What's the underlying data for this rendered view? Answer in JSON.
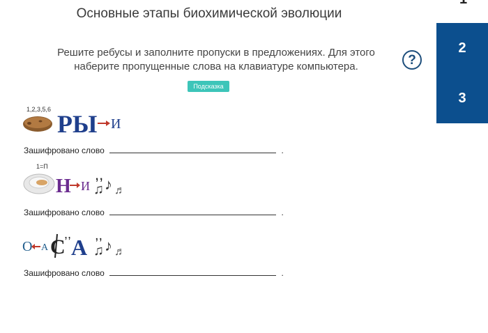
{
  "title": "Основные этапы биохимической эволюции",
  "instructions": {
    "line1": "Решите ребусы и заполните пропуски в предложениях. Для этого",
    "line2": "наберите пропущенные слова на клавиатуре компьютера."
  },
  "help_symbol": "?",
  "hint_button": "Подсказка",
  "nav": {
    "top": "1",
    "item2": "2",
    "item3": "3"
  },
  "rebuses": [
    {
      "caption": "1,2,3,5,6",
      "letters1": "РЫ",
      "letters2": "И",
      "answer_label": "Зашифровано слово",
      "answer_value": "",
      "end": "."
    },
    {
      "caption": "1=П",
      "letters1": "Н",
      "letters2": "И",
      "answer_label": "Зашифровано слово",
      "answer_value": "",
      "end": "."
    },
    {
      "caption": "",
      "letters1": "О",
      "letters2": "А",
      "letters3": "С",
      "letters4": "А",
      "answer_label": "Зашифровано слово",
      "answer_value": "",
      "end": "."
    }
  ],
  "colors": {
    "nav": "#0c4f8e",
    "hint": "#3dc5b9",
    "help": "#1d4e7c"
  }
}
